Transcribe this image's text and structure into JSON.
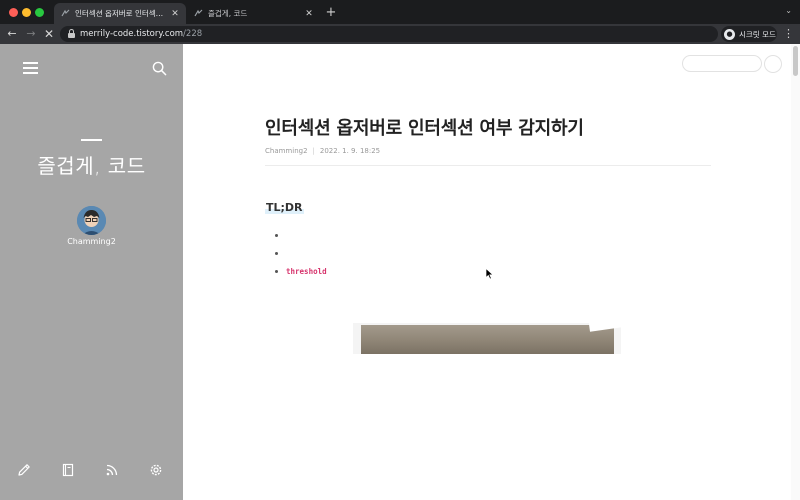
{
  "browser": {
    "tabs": [
      {
        "title": "인터섹션 옵저버로 인터섹션 여부 감지하기",
        "close": "✕",
        "active": true
      },
      {
        "title": "즐겁게, 코드",
        "close": "✕",
        "active": false
      }
    ],
    "new_tab": "+",
    "tab_menu": "⌄",
    "nav": {
      "back": "←",
      "forward": "→",
      "stop": "✕"
    },
    "url": {
      "host": "merrily-code.tistory.com",
      "path": "/228"
    },
    "bookmark": "☆",
    "profile_label": "시크릿 모드",
    "menu": "⋮"
  },
  "sidebar": {
    "blog_title": "즐겁게, 코드",
    "owner_name": "Chamming2"
  },
  "post": {
    "title": "인터섹션 옵저버로 인터섹션 여부 감지하기",
    "author": "Chamming2",
    "date": "2022. 1. 9. 18:25",
    "section_heading": "TL;DR",
    "bullets": [
      "",
      "",
      "threshold"
    ]
  },
  "colors": {
    "sidebar_bg": "#a6a6a6",
    "code_accent": "#d6336c",
    "heading_highlight": "#dff0fa"
  }
}
